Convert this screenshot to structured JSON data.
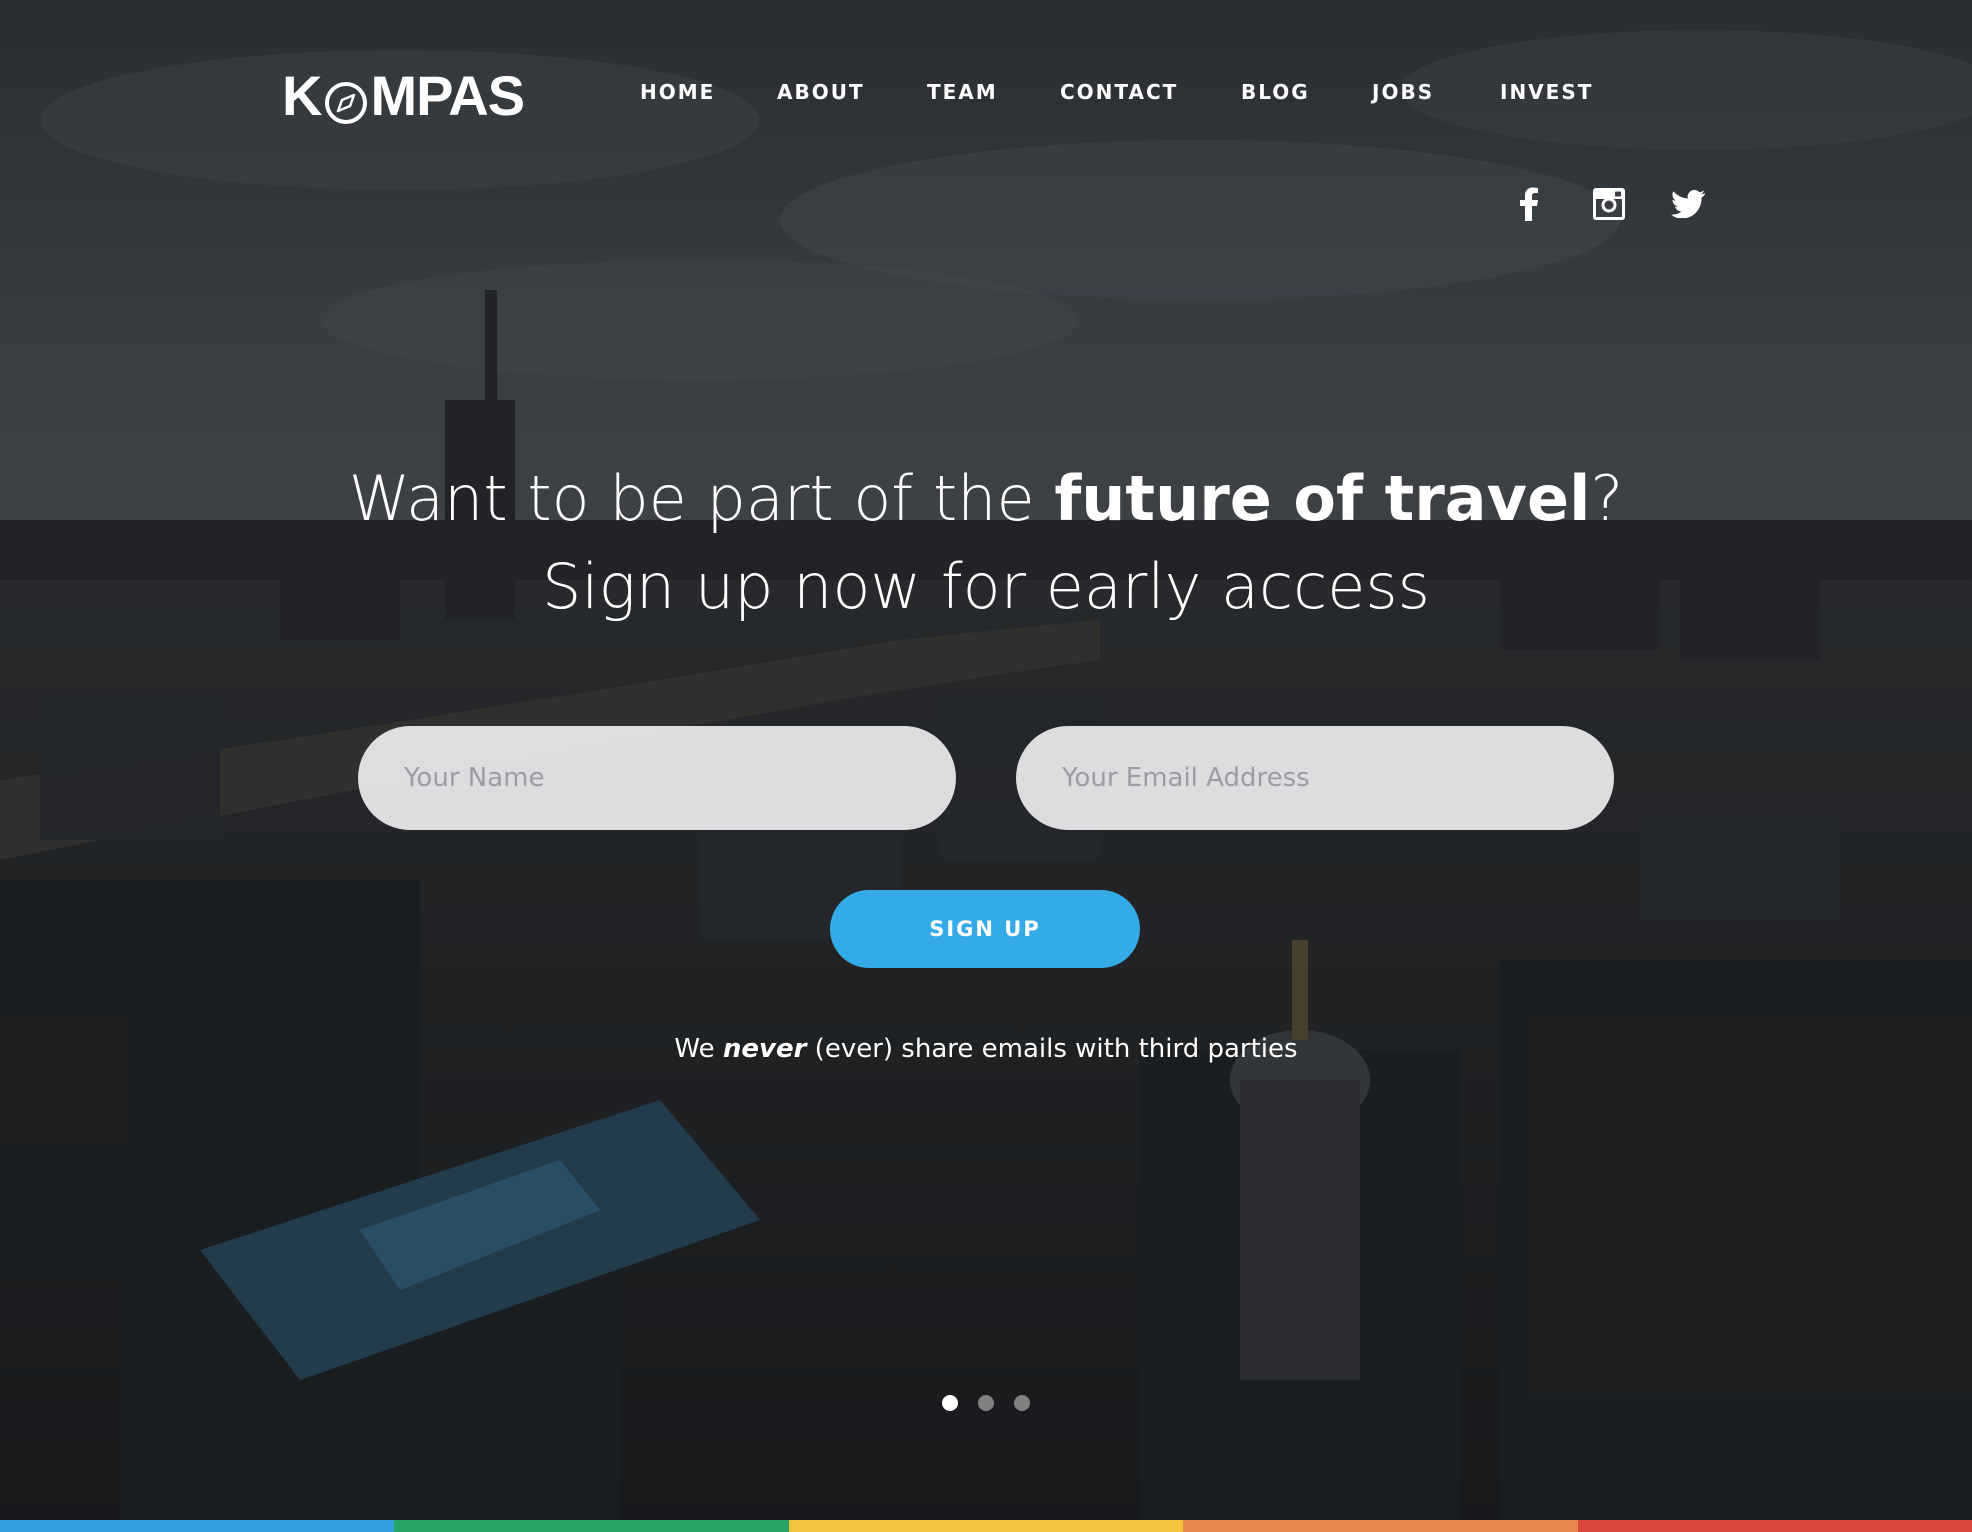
{
  "brand": {
    "logo_prefix": "K",
    "logo_suffix": "MPAS",
    "logo_icon": "compass-icon"
  },
  "nav": {
    "items": [
      {
        "label": "HOME"
      },
      {
        "label": "ABOUT"
      },
      {
        "label": "TEAM"
      },
      {
        "label": "CONTACT"
      },
      {
        "label": "BLOG"
      },
      {
        "label": "JOBS"
      },
      {
        "label": "INVEST"
      }
    ]
  },
  "social": {
    "icons": [
      "facebook-icon",
      "instagram-icon",
      "twitter-icon"
    ]
  },
  "hero": {
    "line1_pre": "Want to be part of the ",
    "line1_bold": "future of travel",
    "line1_post": "?",
    "line2": "Sign up now for early access"
  },
  "form": {
    "name_placeholder": "Your Name",
    "name_value": "",
    "email_placeholder": "Your Email Address",
    "email_value": "",
    "submit_label": "SIGN UP"
  },
  "privacy": {
    "pre": "We ",
    "emphasis": "never",
    "post": " (ever) share emails with third parties"
  },
  "carousel": {
    "slide_count": 3,
    "active_index": 0
  },
  "colors": {
    "accent": "#34abe6",
    "bar": [
      "#2f9fe0",
      "#27a468",
      "#f2c53d",
      "#e8864f",
      "#d9463a"
    ]
  }
}
